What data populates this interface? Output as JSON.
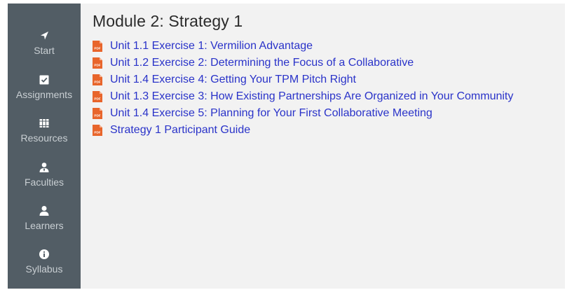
{
  "sidebar": {
    "items": [
      {
        "label": "Start",
        "icon": "navigation-arrow-icon"
      },
      {
        "label": "Assignments",
        "icon": "checkbox-icon"
      },
      {
        "label": "Resources",
        "icon": "books-icon"
      },
      {
        "label": "Faculties",
        "icon": "presenter-icon"
      },
      {
        "label": "Learners",
        "icon": "user-icon"
      },
      {
        "label": "Syllabus",
        "icon": "info-icon"
      }
    ]
  },
  "main": {
    "title": "Module 2: Strategy 1",
    "files": [
      {
        "label": "Unit 1.1 Exercise 1: Vermilion Advantage",
        "icon": "pdf-icon"
      },
      {
        "label": "Unit 1.2 Exercise 2: Determining the Focus of a Collaborative",
        "icon": "pdf-icon"
      },
      {
        "label": "Unit 1.4 Exercise 4: Getting Your TPM Pitch Right",
        "icon": "pdf-icon"
      },
      {
        "label": "Unit 1.3 Exercise 3: How Existing Partnerships Are Organized in Your Community",
        "icon": "pdf-icon"
      },
      {
        "label": "Unit 1.4 Exercise 5: Planning for Your First Collaborative Meeting",
        "icon": "pdf-icon"
      },
      {
        "label": "Strategy 1 Participant Guide",
        "icon": "pdf-icon"
      }
    ]
  },
  "colors": {
    "sidebar_bg": "#525d65",
    "sidebar_text": "#c9cfd3",
    "content_bg": "#f2f2f2",
    "link": "#2a33c9",
    "pdf_icon": "#e8652b"
  }
}
